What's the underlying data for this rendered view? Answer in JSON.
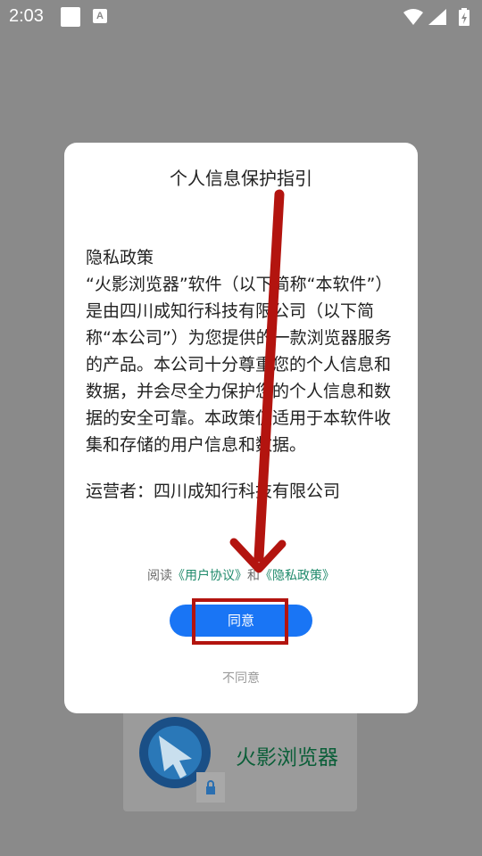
{
  "status_bar": {
    "time": "2:03",
    "icons": [
      "square-notification-icon",
      "a-notification-icon",
      "wifi-icon",
      "signal-icon",
      "battery-icon"
    ]
  },
  "dialog": {
    "title": "个人信息保护指引",
    "policy_heading": "隐私政策",
    "policy_body": "“火影浏览器”软件（以下简称“本软件”）是由四川成知行科技有限公司（以下简称“本公司”）为您提供的一款浏览器服务的产品。本公司十分尊重您的个人信息和数据，并会尽全力保护您的个人信息和数据的安全可靠。本政策仅适用于本软件收集和存储的用户信息和数据。",
    "operator_label": "运营者：四川成知行科技有限公司",
    "read_prefix": "阅读",
    "user_agreement_link": "《用户协议》",
    "and_text": "和",
    "privacy_policy_link": "《隐私政策》",
    "agree_button": "同意",
    "disagree_button": "不同意"
  },
  "background": {
    "app_name": "火影浏览器"
  },
  "colors": {
    "overlay": "#8a8a8a",
    "agree_button": "#1975f5",
    "link": "#1f8a6b",
    "annotation_red": "#b3140f"
  }
}
